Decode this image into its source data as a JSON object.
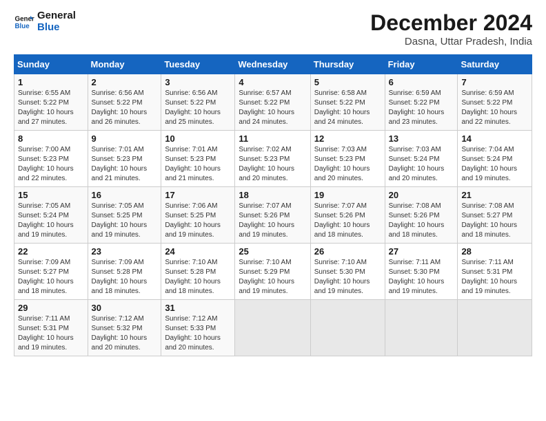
{
  "logo": {
    "line1": "General",
    "line2": "Blue"
  },
  "title": "December 2024",
  "subtitle": "Dasna, Uttar Pradesh, India",
  "days_header": [
    "Sunday",
    "Monday",
    "Tuesday",
    "Wednesday",
    "Thursday",
    "Friday",
    "Saturday"
  ],
  "weeks": [
    [
      {
        "day": "1",
        "detail": "Sunrise: 6:55 AM\nSunset: 5:22 PM\nDaylight: 10 hours\nand 27 minutes."
      },
      {
        "day": "2",
        "detail": "Sunrise: 6:56 AM\nSunset: 5:22 PM\nDaylight: 10 hours\nand 26 minutes."
      },
      {
        "day": "3",
        "detail": "Sunrise: 6:56 AM\nSunset: 5:22 PM\nDaylight: 10 hours\nand 25 minutes."
      },
      {
        "day": "4",
        "detail": "Sunrise: 6:57 AM\nSunset: 5:22 PM\nDaylight: 10 hours\nand 24 minutes."
      },
      {
        "day": "5",
        "detail": "Sunrise: 6:58 AM\nSunset: 5:22 PM\nDaylight: 10 hours\nand 24 minutes."
      },
      {
        "day": "6",
        "detail": "Sunrise: 6:59 AM\nSunset: 5:22 PM\nDaylight: 10 hours\nand 23 minutes."
      },
      {
        "day": "7",
        "detail": "Sunrise: 6:59 AM\nSunset: 5:22 PM\nDaylight: 10 hours\nand 22 minutes."
      }
    ],
    [
      {
        "day": "8",
        "detail": "Sunrise: 7:00 AM\nSunset: 5:23 PM\nDaylight: 10 hours\nand 22 minutes."
      },
      {
        "day": "9",
        "detail": "Sunrise: 7:01 AM\nSunset: 5:23 PM\nDaylight: 10 hours\nand 21 minutes."
      },
      {
        "day": "10",
        "detail": "Sunrise: 7:01 AM\nSunset: 5:23 PM\nDaylight: 10 hours\nand 21 minutes."
      },
      {
        "day": "11",
        "detail": "Sunrise: 7:02 AM\nSunset: 5:23 PM\nDaylight: 10 hours\nand 20 minutes."
      },
      {
        "day": "12",
        "detail": "Sunrise: 7:03 AM\nSunset: 5:23 PM\nDaylight: 10 hours\nand 20 minutes."
      },
      {
        "day": "13",
        "detail": "Sunrise: 7:03 AM\nSunset: 5:24 PM\nDaylight: 10 hours\nand 20 minutes."
      },
      {
        "day": "14",
        "detail": "Sunrise: 7:04 AM\nSunset: 5:24 PM\nDaylight: 10 hours\nand 19 minutes."
      }
    ],
    [
      {
        "day": "15",
        "detail": "Sunrise: 7:05 AM\nSunset: 5:24 PM\nDaylight: 10 hours\nand 19 minutes."
      },
      {
        "day": "16",
        "detail": "Sunrise: 7:05 AM\nSunset: 5:25 PM\nDaylight: 10 hours\nand 19 minutes."
      },
      {
        "day": "17",
        "detail": "Sunrise: 7:06 AM\nSunset: 5:25 PM\nDaylight: 10 hours\nand 19 minutes."
      },
      {
        "day": "18",
        "detail": "Sunrise: 7:07 AM\nSunset: 5:26 PM\nDaylight: 10 hours\nand 19 minutes."
      },
      {
        "day": "19",
        "detail": "Sunrise: 7:07 AM\nSunset: 5:26 PM\nDaylight: 10 hours\nand 18 minutes."
      },
      {
        "day": "20",
        "detail": "Sunrise: 7:08 AM\nSunset: 5:26 PM\nDaylight: 10 hours\nand 18 minutes."
      },
      {
        "day": "21",
        "detail": "Sunrise: 7:08 AM\nSunset: 5:27 PM\nDaylight: 10 hours\nand 18 minutes."
      }
    ],
    [
      {
        "day": "22",
        "detail": "Sunrise: 7:09 AM\nSunset: 5:27 PM\nDaylight: 10 hours\nand 18 minutes."
      },
      {
        "day": "23",
        "detail": "Sunrise: 7:09 AM\nSunset: 5:28 PM\nDaylight: 10 hours\nand 18 minutes."
      },
      {
        "day": "24",
        "detail": "Sunrise: 7:10 AM\nSunset: 5:28 PM\nDaylight: 10 hours\nand 18 minutes."
      },
      {
        "day": "25",
        "detail": "Sunrise: 7:10 AM\nSunset: 5:29 PM\nDaylight: 10 hours\nand 19 minutes."
      },
      {
        "day": "26",
        "detail": "Sunrise: 7:10 AM\nSunset: 5:30 PM\nDaylight: 10 hours\nand 19 minutes."
      },
      {
        "day": "27",
        "detail": "Sunrise: 7:11 AM\nSunset: 5:30 PM\nDaylight: 10 hours\nand 19 minutes."
      },
      {
        "day": "28",
        "detail": "Sunrise: 7:11 AM\nSunset: 5:31 PM\nDaylight: 10 hours\nand 19 minutes."
      }
    ],
    [
      {
        "day": "29",
        "detail": "Sunrise: 7:11 AM\nSunset: 5:31 PM\nDaylight: 10 hours\nand 19 minutes."
      },
      {
        "day": "30",
        "detail": "Sunrise: 7:12 AM\nSunset: 5:32 PM\nDaylight: 10 hours\nand 20 minutes."
      },
      {
        "day": "31",
        "detail": "Sunrise: 7:12 AM\nSunset: 5:33 PM\nDaylight: 10 hours\nand 20 minutes."
      },
      null,
      null,
      null,
      null
    ]
  ]
}
